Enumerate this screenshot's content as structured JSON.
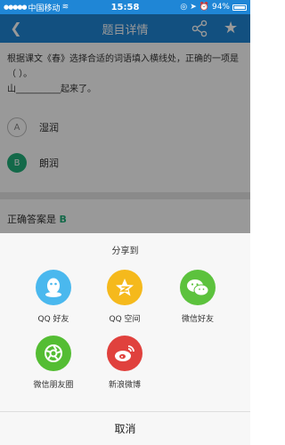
{
  "status_bar": {
    "carrier": "中国移动",
    "time": "15:58",
    "battery": "94%"
  },
  "nav": {
    "title": "题目详情",
    "back_icon": "chevron-left-icon",
    "share_icon": "share-icon",
    "star_icon": "star-icon"
  },
  "question": {
    "text": "根据课文《春》选择合适的词语填入横线处，正确的一项是（ ）。",
    "blank_line": "山__________起来了。",
    "options": [
      {
        "letter": "A",
        "text": "湿润"
      },
      {
        "letter": "B",
        "text": "朗润"
      }
    ],
    "answer_label": "正确答案是",
    "answer_value": "B"
  },
  "share_sheet": {
    "title": "分享到",
    "items": [
      {
        "label": "QQ 好友",
        "icon": "qq-icon",
        "color": "#4ab8ee"
      },
      {
        "label": "QQ 空间",
        "icon": "qzone-icon",
        "color": "#f5b91c"
      },
      {
        "label": "微信好友",
        "icon": "wechat-icon",
        "color": "#5cc23d"
      },
      {
        "label": "微信朋友圈",
        "icon": "moments-icon",
        "color": "#54bd33"
      },
      {
        "label": "新浪微博",
        "icon": "weibo-icon",
        "color": "#e0413d"
      }
    ],
    "cancel_label": "取消"
  }
}
